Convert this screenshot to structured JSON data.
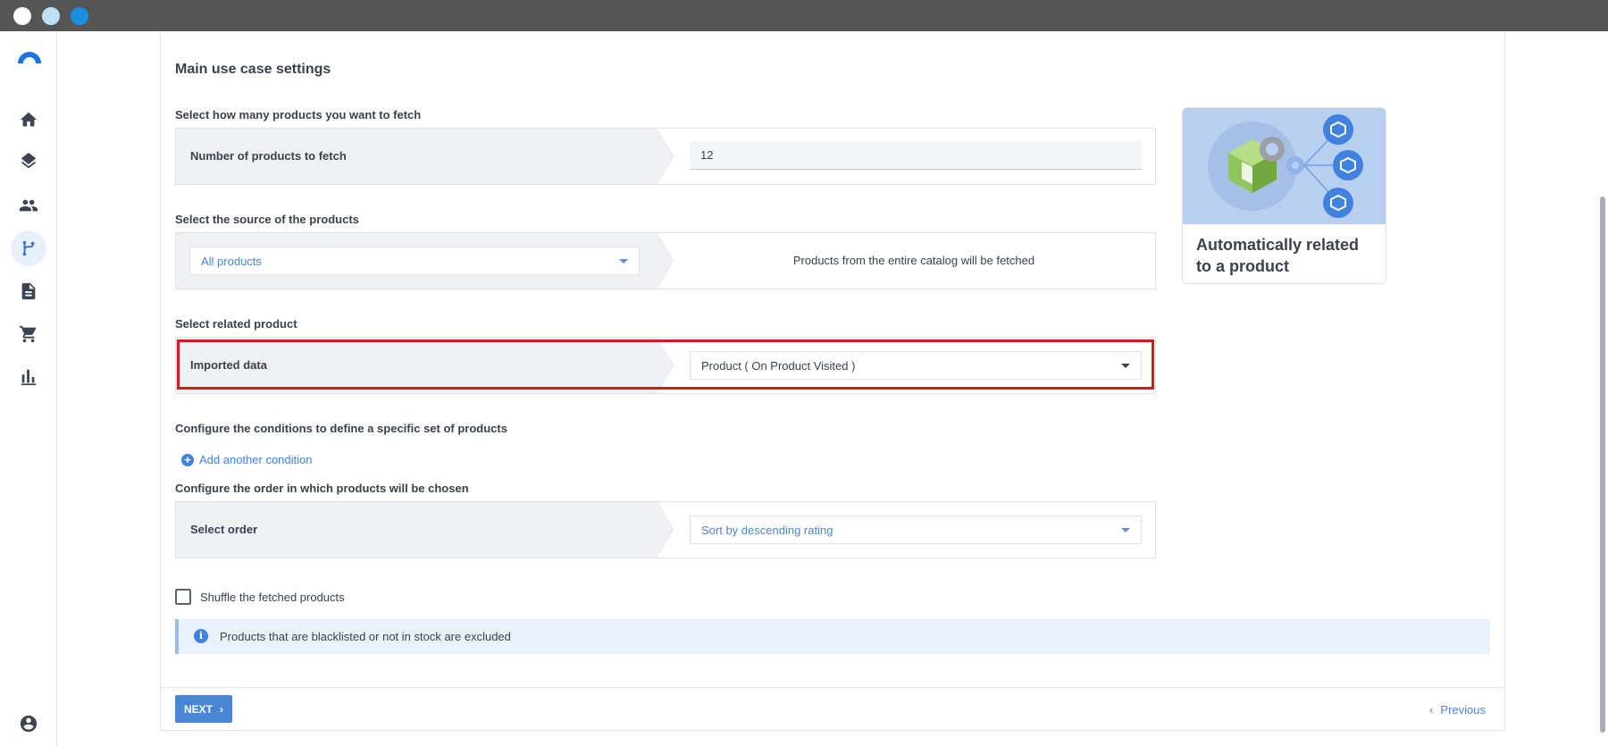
{
  "window": {
    "controls": [
      "close",
      "minimize",
      "maximize"
    ]
  },
  "sidebar": {
    "items": [
      {
        "icon": "home-icon"
      },
      {
        "icon": "layers-icon"
      },
      {
        "icon": "people-icon"
      },
      {
        "icon": "branch-icon",
        "active": true
      },
      {
        "icon": "document-icon"
      },
      {
        "icon": "cart-icon"
      },
      {
        "icon": "bar-chart-icon"
      }
    ],
    "account_icon": "account-icon"
  },
  "main": {
    "title": "Main use case settings",
    "fetch_section": {
      "label": "Select how many products you want to fetch",
      "row_label": "Number of products to fetch",
      "value": "12"
    },
    "source_section": {
      "label": "Select the source of the products",
      "selected": "All products",
      "description": "Products from the entire catalog will be fetched"
    },
    "related_section": {
      "label": "Select related product",
      "row_label": "Imported data",
      "selected": "Product ( On Product Visited )"
    },
    "conditions_section": {
      "label": "Configure the conditions to define a specific set of products",
      "add_label": "Add another condition"
    },
    "order_section": {
      "label": "Configure the order in which products will be chosen",
      "row_label": "Select order",
      "selected": "Sort by descending rating"
    },
    "shuffle_label": "Shuffle the fetched products",
    "shuffle_checked": false,
    "info_text": "Products that are blacklisted or not in stock are excluded"
  },
  "illustration": {
    "title": "Automatically related to a product"
  },
  "footer": {
    "next_label": "NEXT",
    "previous_label": "Previous"
  },
  "colors": {
    "accent": "#4a86d8",
    "highlight_border": "#d61a1a",
    "info_bg": "#e9f1fc"
  }
}
